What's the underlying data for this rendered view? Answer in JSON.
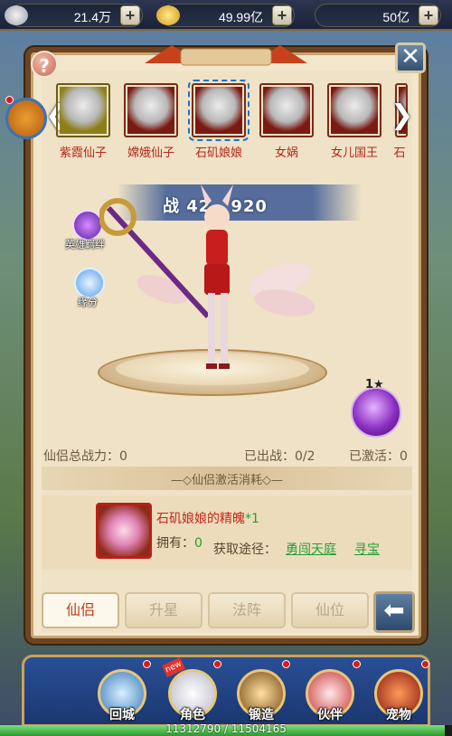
{
  "resources": [
    {
      "name": "silver",
      "value": "21.4万",
      "plus": "+"
    },
    {
      "name": "gold",
      "value": "49.99亿",
      "plus": "+"
    },
    {
      "name": "jade",
      "value": "50亿",
      "plus": "+"
    }
  ],
  "help": {
    "label": "?"
  },
  "close": {
    "label": "✕"
  },
  "fairies": [
    {
      "name": "紫霞仙子"
    },
    {
      "name": "嫦娥仙子"
    },
    {
      "name": "石矶娘娘"
    },
    {
      "name": "女娲"
    },
    {
      "name": "女儿国王"
    },
    {
      "name": "石"
    }
  ],
  "selected_fairy_index": 2,
  "arrows": {
    "left": "❮",
    "right": "❯"
  },
  "combat": {
    "label": "战 42",
    "value": "920"
  },
  "side_badges": [
    {
      "label": "英雄羁绊"
    },
    {
      "label": "缘分"
    }
  ],
  "orb": {
    "stars": "1★"
  },
  "stats": {
    "total_power": "仙侣总战力：0",
    "deployed": "已出战：0/2",
    "activated": "已激活：0"
  },
  "cost_section": {
    "title": "仙侣激活消耗",
    "item_name": "石矶娘娘的精魄",
    "item_qty": "*1",
    "own_label": "拥有：",
    "own_value": "0",
    "source_label": "获取途径：",
    "sources": [
      "勇闯天庭",
      "寻宝"
    ]
  },
  "tabs": [
    {
      "label": "仙侣",
      "active": true
    },
    {
      "label": "升星",
      "active": false
    },
    {
      "label": "法阵",
      "active": false
    },
    {
      "label": "仙位",
      "active": false
    }
  ],
  "back": {
    "label": "⬅"
  },
  "bottom_nav": [
    {
      "label": "回城"
    },
    {
      "label": "角色"
    },
    {
      "label": "锻造"
    },
    {
      "label": "伙伴"
    },
    {
      "label": "宠物"
    }
  ],
  "new_tag": "new",
  "xp": {
    "text": "11312790 / 11504165",
    "fraction": 0.9834
  }
}
